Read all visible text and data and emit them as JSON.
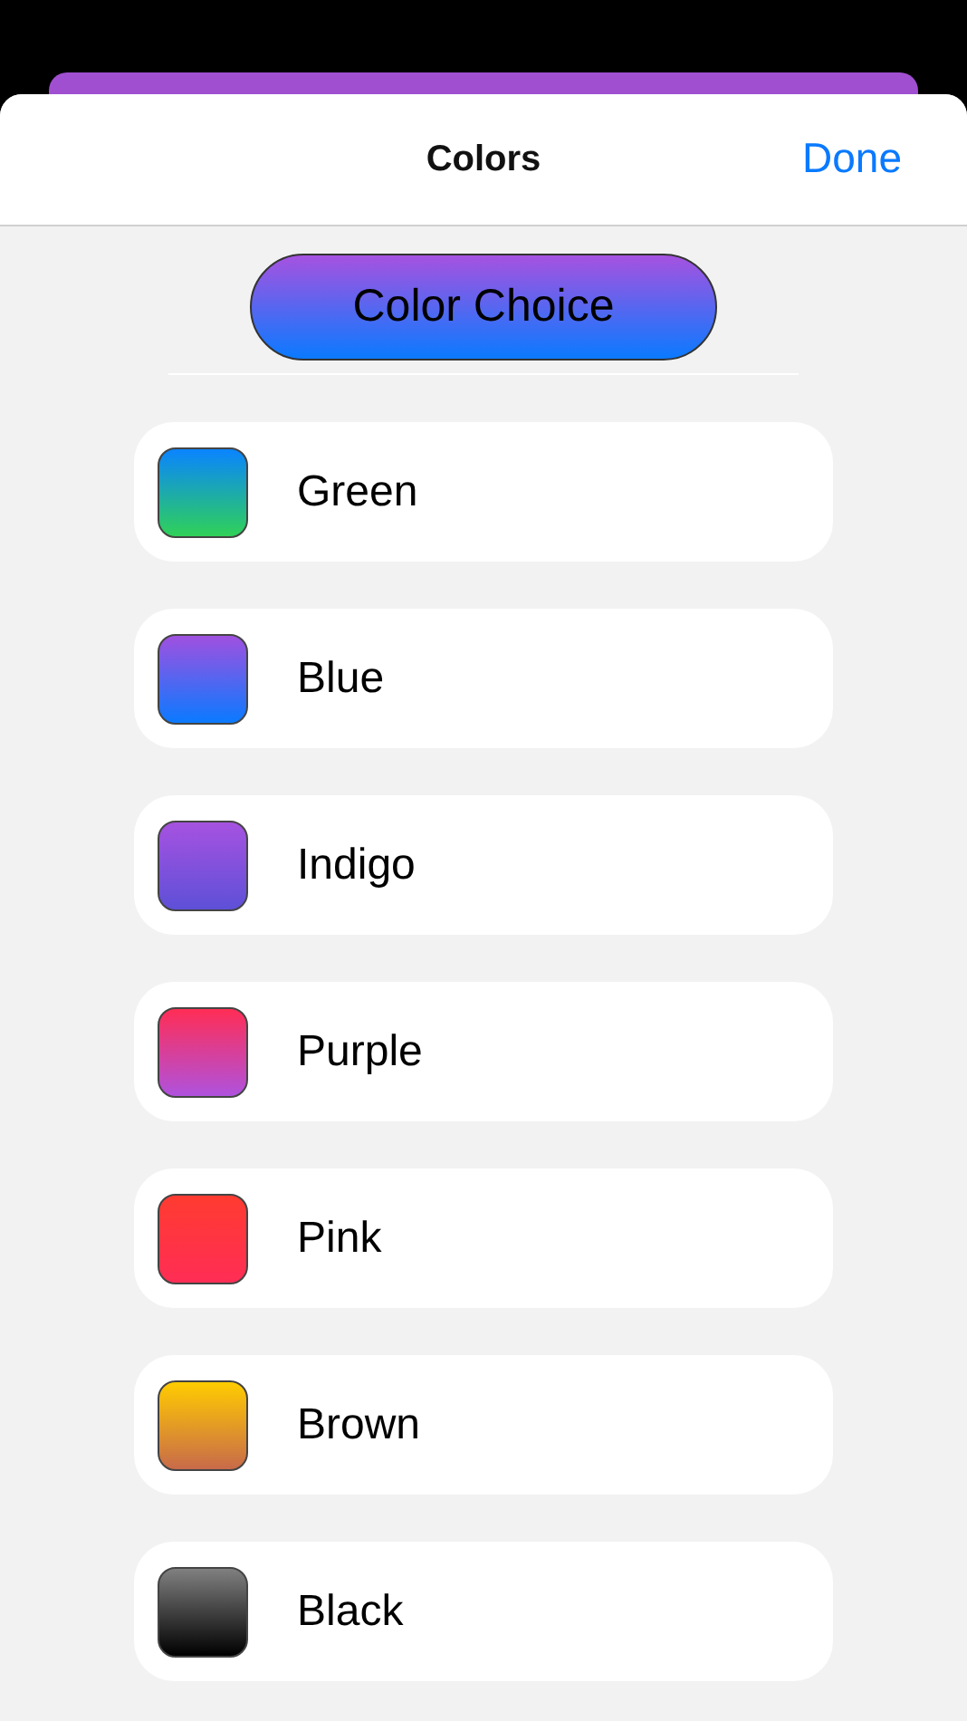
{
  "header": {
    "title": "Colors",
    "done": "Done"
  },
  "choice_button": {
    "label": "Color Choice"
  },
  "colors": [
    {
      "name": "Green",
      "gradient": [
        {
          "color": "#0a84ff"
        },
        {
          "color": "#30d158"
        }
      ]
    },
    {
      "name": "Blue",
      "gradient": [
        {
          "color": "#a050e0"
        },
        {
          "color": "#0a7aff"
        }
      ]
    },
    {
      "name": "Indigo",
      "gradient": [
        {
          "color": "#a652e0"
        },
        {
          "color": "#5e50d8"
        }
      ]
    },
    {
      "name": "Purple",
      "gradient": [
        {
          "color": "#ff2d55"
        },
        {
          "color": "#af52de"
        }
      ]
    },
    {
      "name": "Pink",
      "gradient": [
        {
          "color": "#ff3b30"
        },
        {
          "color": "#ff2d55"
        }
      ]
    },
    {
      "name": "Brown",
      "gradient": [
        {
          "color": "#ffcc00"
        },
        {
          "color": "#c86a4a"
        }
      ]
    },
    {
      "name": "Black",
      "gradient": [
        {
          "color": "#808080"
        },
        {
          "color": "#000000"
        }
      ]
    }
  ]
}
